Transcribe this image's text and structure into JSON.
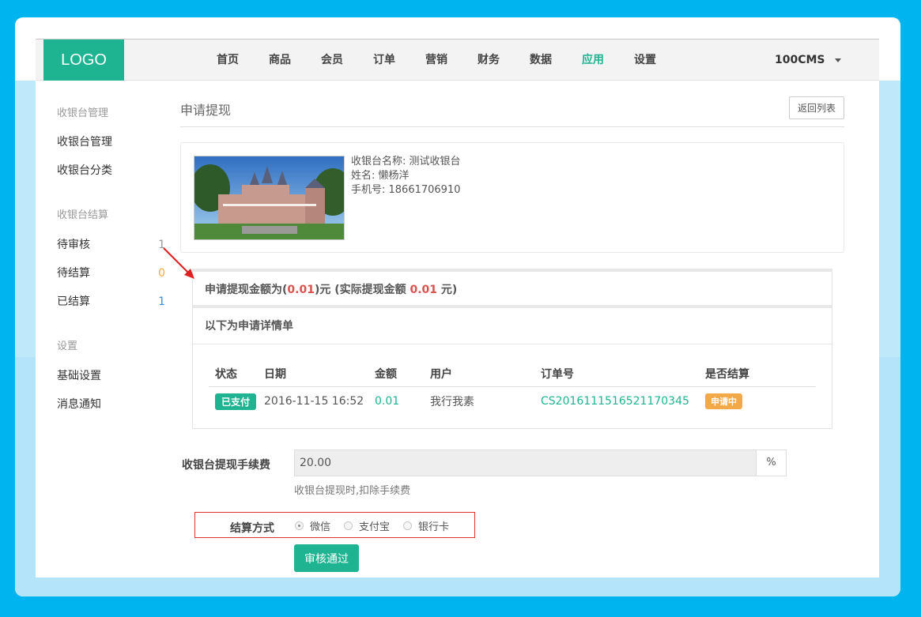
{
  "header": {
    "logo": "LOGO",
    "nav": [
      "首页",
      "商品",
      "会员",
      "订单",
      "营销",
      "财务",
      "数据",
      "应用",
      "设置"
    ],
    "active_nav": "应用",
    "user": "100CMS"
  },
  "sidebar": {
    "group1": "收银台管理",
    "items1": [
      "收银台管理",
      "收银台分类"
    ],
    "group2": "收银台结算",
    "pending": {
      "label": "待审核",
      "count": "1"
    },
    "to_settle": {
      "label": "待结算",
      "count": "0"
    },
    "settled": {
      "label": "已结算",
      "count": "1"
    },
    "group3": "设置",
    "items3": [
      "基础设置",
      "消息通知"
    ]
  },
  "main": {
    "title": "申请提现",
    "back_button": "返回列表",
    "cashier_name": "收银台名称: 测试收银台",
    "person_name": "姓名: 懒杨洋",
    "phone": "手机号: 18661706910",
    "amount_prefix": "申请提现金额为(",
    "amount": "0.01",
    "amount_mid": ")元 (实际提现金额 ",
    "actual_amount": "0.01",
    "amount_suffix": " 元)",
    "detail_title": "以下为申请详情单",
    "table_headers": [
      "状态",
      "日期",
      "金额",
      "用户",
      "订单号",
      "是否结算"
    ],
    "row": {
      "status": "已支付",
      "date": "2016-11-15 16:52",
      "amount": "0.01",
      "user": "我行我素",
      "order_no": "CS2016111516521170345",
      "settle": "申请中"
    },
    "fee_label": "收银台提现手续费",
    "fee_value": "20.00",
    "fee_unit": "%",
    "fee_help": "收银台提现时,扣除手续费",
    "settle_label": "结算方式",
    "settle_options": [
      "微信",
      "支付宝",
      "银行卡"
    ],
    "approve_button": "审核通过"
  },
  "colors": {
    "accent": "#1fb491",
    "background": "#00b4f0",
    "warning": "#f4a948",
    "danger": "#d9534f"
  }
}
